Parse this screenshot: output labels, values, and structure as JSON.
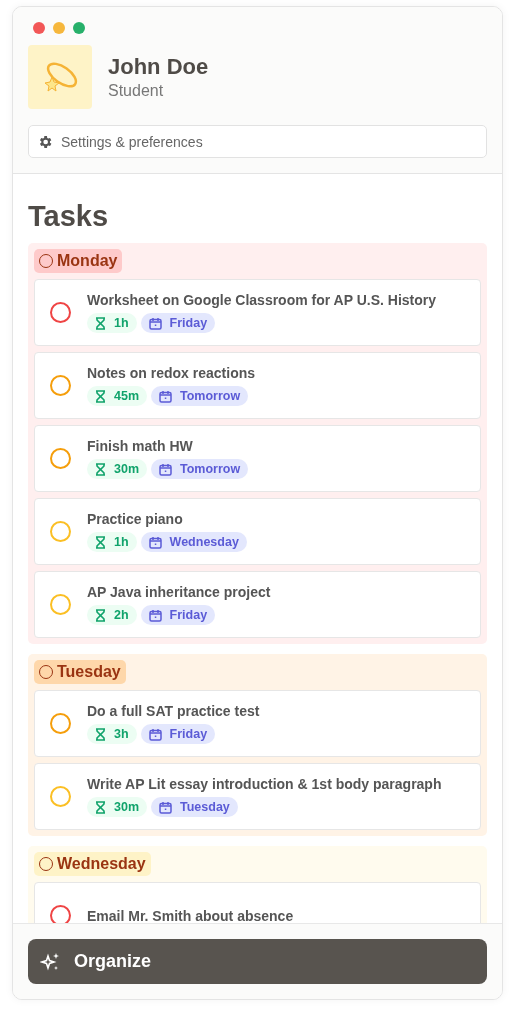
{
  "profile": {
    "name": "John Doe",
    "role": "Student"
  },
  "settings_button": {
    "label": "Settings & preferences"
  },
  "title": "Tasks",
  "groups": [
    {
      "day": "Monday",
      "color": "#fecaca",
      "tasks": [
        {
          "title": "Worksheet on Google Classroom for AP U.S. History",
          "color": "#ef4444",
          "checked": false,
          "duration": "1h",
          "due": "Friday"
        },
        {
          "title": "Notes on redox reactions",
          "color": "#f59e0b",
          "checked": false,
          "duration": "45m",
          "due": "Tomorrow"
        },
        {
          "title": "Finish math HW",
          "color": "#f59e0b",
          "checked": false,
          "duration": "30m",
          "due": "Tomorrow"
        },
        {
          "title": "Practice piano",
          "color": "#fbbf24",
          "checked": false,
          "duration": "1h",
          "due": "Wednesday"
        },
        {
          "title": "AP Java inheritance project",
          "color": "#fbbf24",
          "checked": false,
          "duration": "2h",
          "due": "Friday"
        }
      ]
    },
    {
      "day": "Tuesday",
      "color": "#fed7aa",
      "tasks": [
        {
          "title": "Do a full SAT practice test",
          "color": "#f59e0b",
          "checked": false,
          "duration": "3h",
          "due": "Friday"
        },
        {
          "title": "Write AP Lit essay introduction & 1st body paragraph",
          "color": "#fbbf24",
          "checked": false,
          "duration": "30m",
          "due": "Tuesday"
        }
      ]
    },
    {
      "day": "Wednesday",
      "color": "#fef3c7",
      "tasks": [
        {
          "title": "Email Mr. Smith about absence",
          "color": "#ef4444",
          "checked": false
        }
      ]
    }
  ],
  "organize_button": {
    "label": "Organize"
  }
}
